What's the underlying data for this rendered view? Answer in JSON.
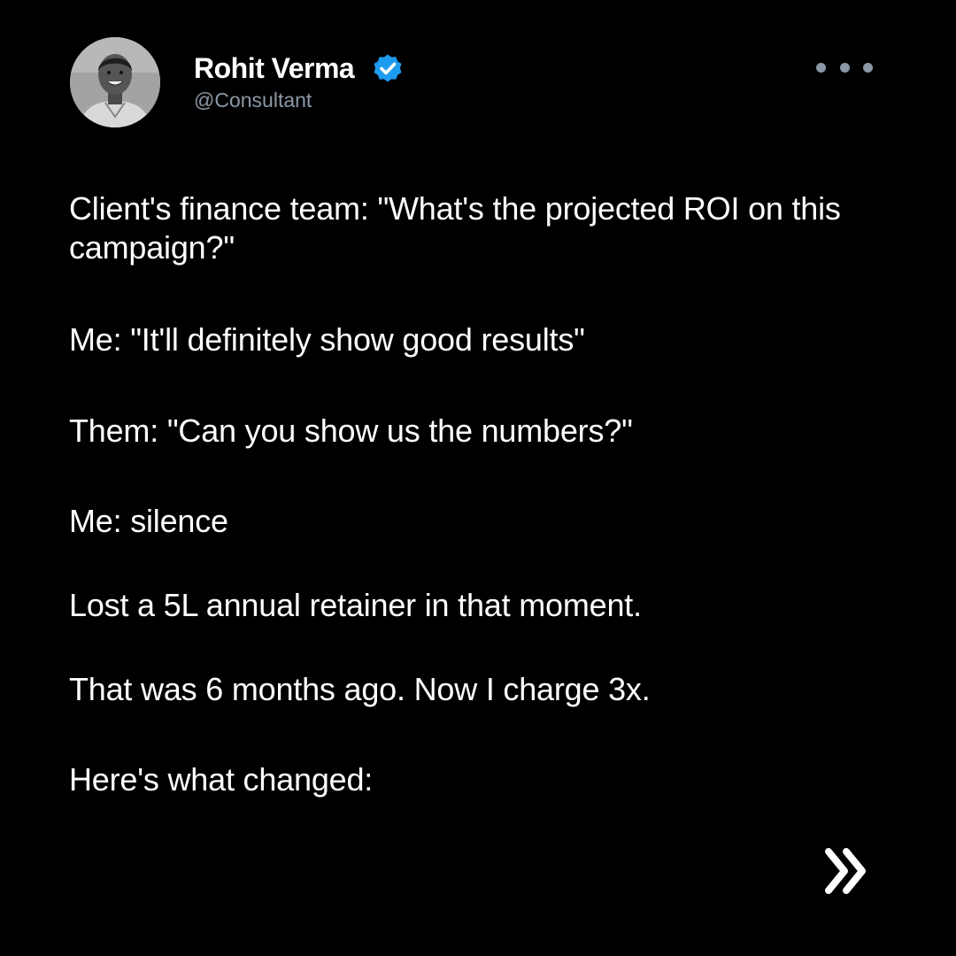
{
  "author": {
    "name": "Rohit Verma",
    "handle": "@Consultant",
    "verified": true,
    "avatar_icon": "profile-photo",
    "verified_icon": "verified-badge-icon",
    "verified_color": "#1d9bf0"
  },
  "menu_icon": "more-options-icon",
  "post": {
    "paragraphs": [
      "Client's finance team: \"What's the projected ROI on this campaign?\"",
      "Me: \"It'll definitely show good results\"",
      "Them: \"Can you show us the numbers?\"",
      "Me: silence",
      "Lost a 5L annual retainer in that moment.",
      "That was 6 months ago. Now I charge 3x.",
      "Here's what changed:"
    ]
  },
  "next_icon": "double-chevron-right-icon",
  "colors": {
    "background": "#000000",
    "text": "#ffffff",
    "muted": "#8b98a5"
  }
}
